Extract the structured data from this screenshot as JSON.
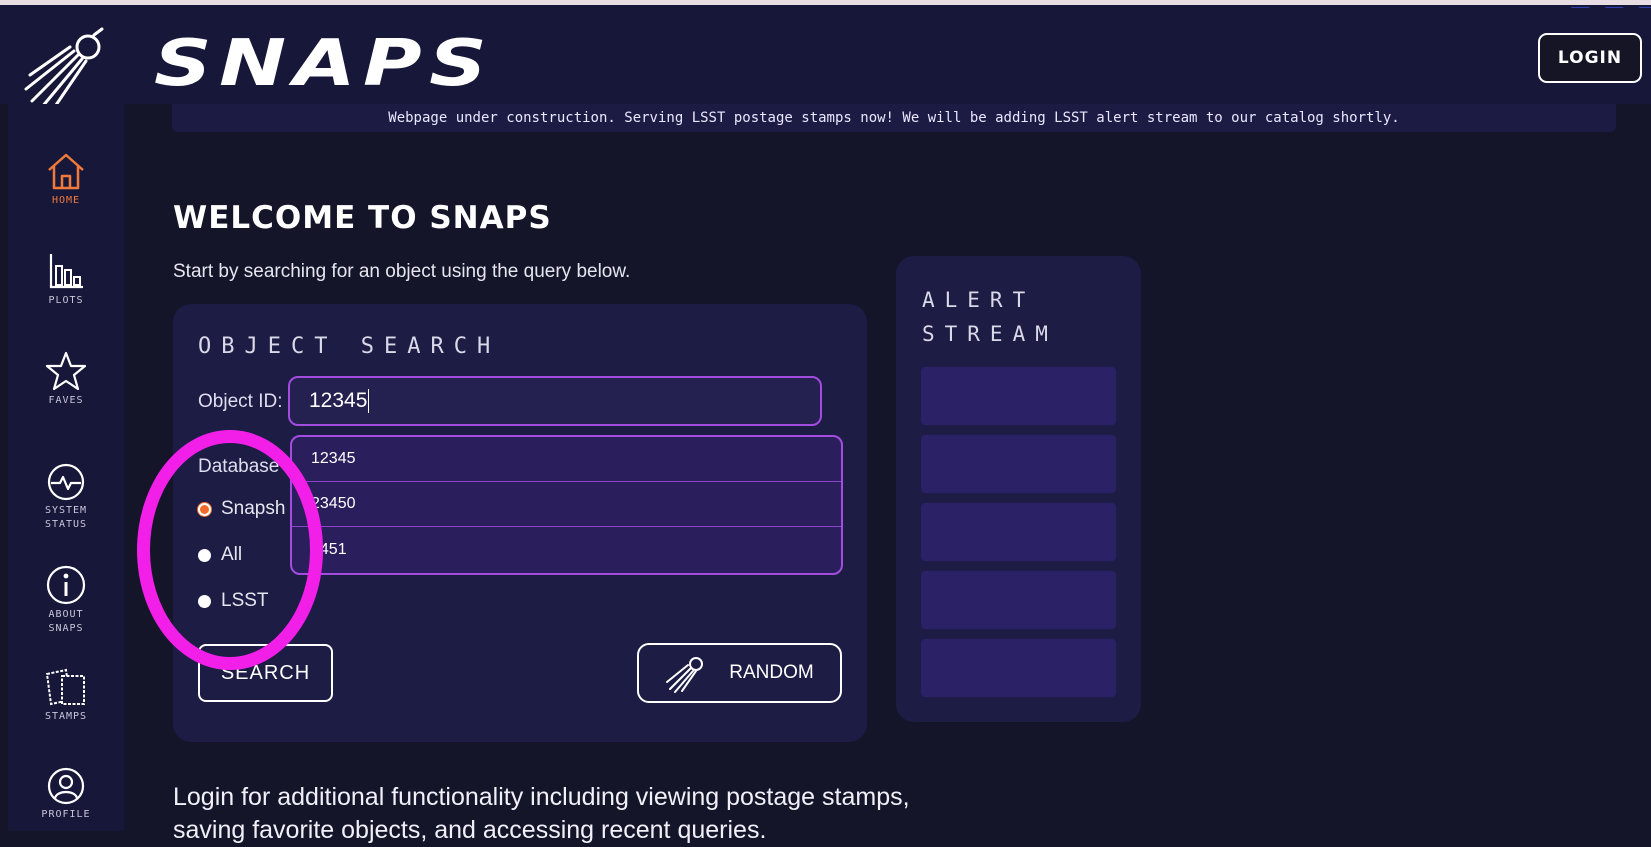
{
  "header": {
    "brand": "SNAPS",
    "login_label": "LOGIN",
    "banner": "Webpage under construction. Serving LSST postage stamps now! We will be adding LSST alert stream to our catalog shortly."
  },
  "sidebar": {
    "items": [
      {
        "label": "HOME",
        "icon": "home-icon",
        "active": true
      },
      {
        "label": "PLOTS",
        "icon": "bar-chart-icon"
      },
      {
        "label": "FAVES",
        "icon": "star-icon"
      },
      {
        "label": "SYSTEM STATUS",
        "line1": "SYSTEM",
        "line2": "STATUS",
        "icon": "heartbeat-icon"
      },
      {
        "label": "ABOUT SNAPS",
        "line1": "ABOUT",
        "line2": "SNAPS",
        "icon": "info-icon"
      },
      {
        "label": "STAMPS",
        "icon": "stamps-icon"
      },
      {
        "label": "PROFILE",
        "icon": "profile-icon"
      }
    ]
  },
  "main": {
    "title": "WELCOME TO SNAPS",
    "subtitle": "Start by searching for an object using the query below.",
    "bottom_text": "Login for additional functionality including viewing postage stamps, saving favorite objects, and accessing recent queries."
  },
  "search": {
    "title": "OBJECT SEARCH",
    "object_id_label": "Object ID:",
    "object_id_value": "12345",
    "database_label": "Database v",
    "radio_options": [
      {
        "label": "Snapsh",
        "checked": true
      },
      {
        "label": "All",
        "checked": false
      },
      {
        "label": "LSST",
        "checked": false
      }
    ],
    "search_button": "SEARCH",
    "random_button": "RANDOM",
    "suggestions": [
      "12345",
      "23450",
      "3451"
    ]
  },
  "alert_stream": {
    "title_line1": "ALERT",
    "title_line2": "STREAM",
    "slot_count": 5
  },
  "colors": {
    "accent_purple": "#a24de0",
    "active_orange": "#f07a3a",
    "annotation_magenta": "#f21fe8",
    "panel_bg": "#1c1c45"
  }
}
